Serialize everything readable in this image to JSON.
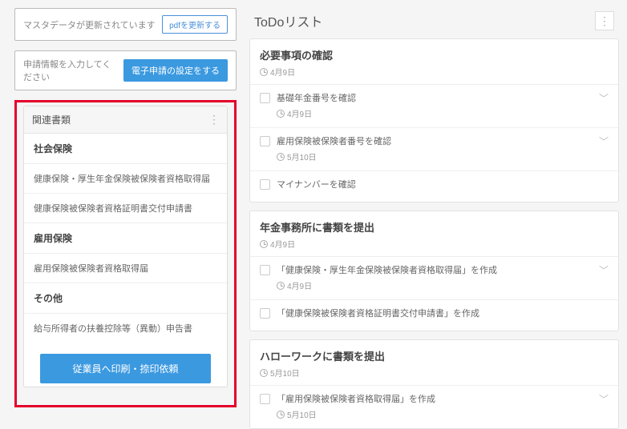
{
  "left": {
    "notices": [
      {
        "text": "マスタデータが更新されています",
        "button": "pdfを更新する",
        "btnStyle": "outline"
      },
      {
        "text": "申請情報を入力してください",
        "button": "電子申請の設定をする",
        "btnStyle": "filled"
      }
    ],
    "docsHeader": "関連書類",
    "docGroups": [
      {
        "title": "社会保険",
        "items": [
          "健康保険・厚生年金保険被保険者資格取得届",
          "健康保険被保険者資格証明書交付申請書"
        ]
      },
      {
        "title": "雇用保険",
        "items": [
          "雇用保険被保険者資格取得届"
        ]
      },
      {
        "title": "その他",
        "items": [
          "給与所得者の扶養控除等（異動）申告書"
        ]
      }
    ],
    "printBtn": "従業員へ印刷・捺印依頼"
  },
  "right": {
    "title": "ToDoリスト",
    "cards": [
      {
        "title": "必要事項の確認",
        "date": "4月9日",
        "items": [
          {
            "text": "基礎年金番号を確認",
            "date": "4月9日",
            "expandable": true
          },
          {
            "text": "雇用保険被保険者番号を確認",
            "date": "5月10日",
            "expandable": true
          },
          {
            "text": "マイナンバーを確認",
            "date": "",
            "expandable": false
          }
        ]
      },
      {
        "title": "年金事務所に書類を提出",
        "date": "4月9日",
        "items": [
          {
            "text": "「健康保険・厚生年金保険被保険者資格取得届」を作成",
            "date": "4月9日",
            "expandable": true
          },
          {
            "text": "「健康保険被保険者資格証明書交付申請書」を作成",
            "date": "",
            "expandable": false
          }
        ]
      },
      {
        "title": "ハローワークに書類を提出",
        "date": "5月10日",
        "items": [
          {
            "text": "「雇用保険被保険者資格取得届」を作成",
            "date": "5月10日",
            "expandable": true
          }
        ]
      }
    ]
  }
}
